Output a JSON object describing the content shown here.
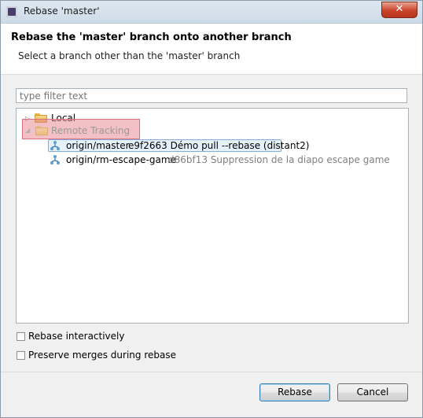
{
  "window": {
    "title": "Rebase 'master'",
    "close_glyph": "✕"
  },
  "header": {
    "title": "Rebase the 'master' branch onto another branch",
    "subtitle": "Select a branch other than the 'master' branch"
  },
  "filter": {
    "placeholder": "type filter text",
    "value": ""
  },
  "tree": {
    "local": {
      "label": "Local",
      "icon": "folder-icon"
    },
    "remote": {
      "label": "Remote Tracking",
      "icon": "folder-open-icon"
    },
    "branches": [
      {
        "name": "origin/master",
        "commit": "e9f2663 Démo pull --rebase (distant2)",
        "selected": true
      },
      {
        "name": "origin/rm-escape-game",
        "commit": "d86bf13 Suppression de la diapo escape game",
        "selected": false
      }
    ]
  },
  "options": {
    "interactive": {
      "label": "Rebase interactively",
      "checked": false
    },
    "preserve_merges": {
      "label": "Preserve merges during rebase",
      "checked": false
    }
  },
  "buttons": {
    "rebase": "Rebase",
    "cancel": "Cancel"
  },
  "colors": {
    "highlight": "#e88c96",
    "selection": "#e5f1fb",
    "folder": "#e9b64b"
  }
}
